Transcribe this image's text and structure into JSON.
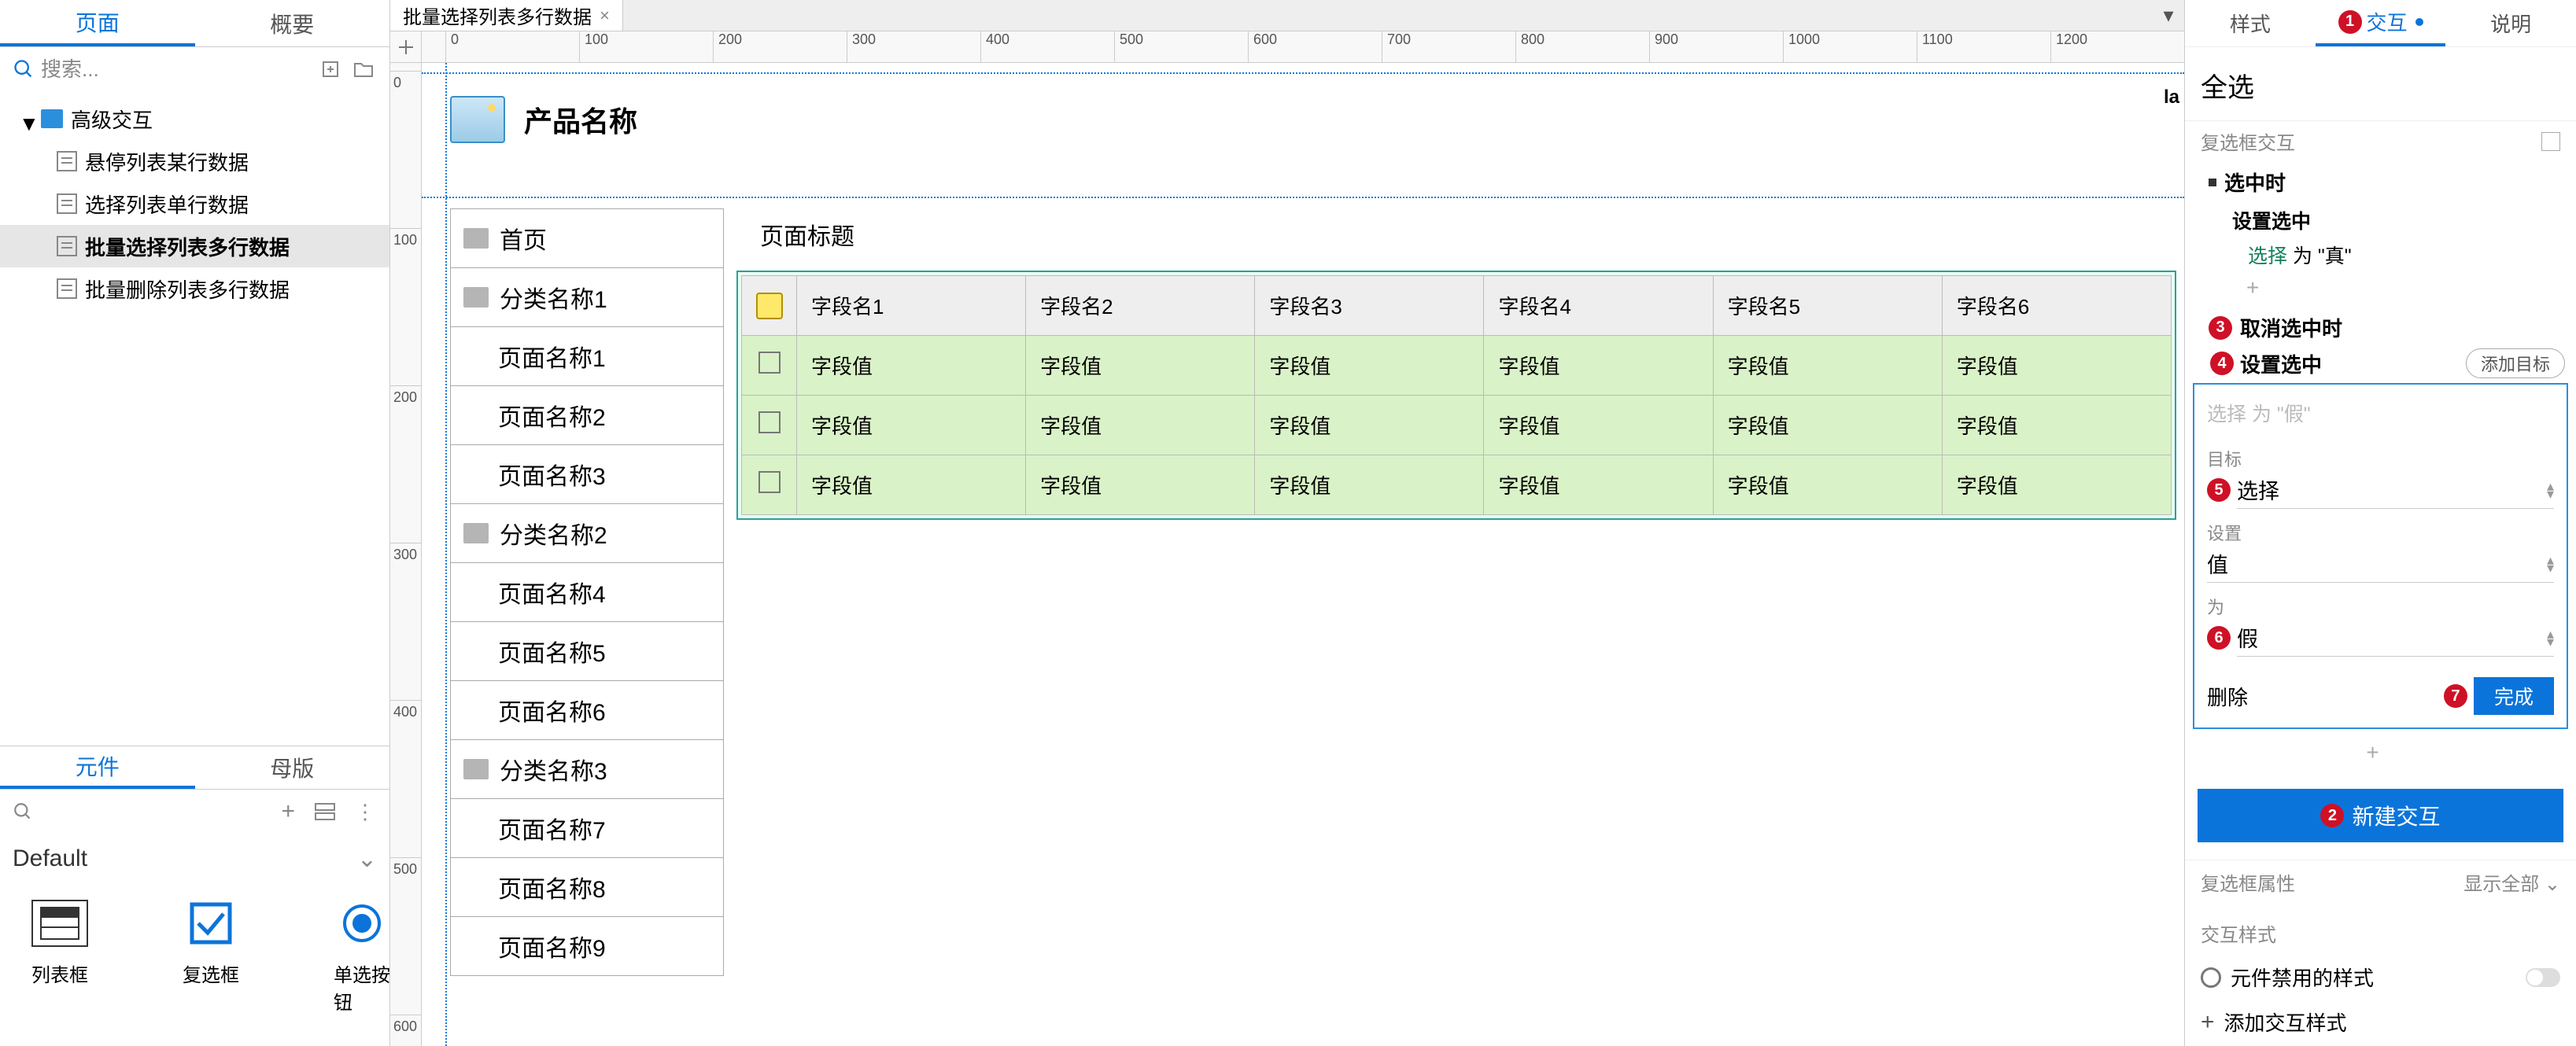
{
  "left_panel": {
    "tabs": {
      "page": "页面",
      "summary": "概要"
    },
    "search_placeholder": "搜索...",
    "tree": {
      "root": "高级交互",
      "items": [
        "悬停列表某行数据",
        "选择列表单行数据",
        "批量选择列表多行数据",
        "批量删除列表多行数据"
      ],
      "selected_index": 2
    },
    "widget_tabs": {
      "widget": "元件",
      "master": "母版"
    },
    "library": "Default",
    "widgets": [
      {
        "key": "listbox",
        "label": "列表框"
      },
      {
        "key": "checkbox",
        "label": "复选框"
      },
      {
        "key": "radio",
        "label": "单选按钮"
      }
    ]
  },
  "doc_tabs": {
    "active": "批量选择列表多行数据"
  },
  "ruler_h": [
    "0",
    "100",
    "200",
    "300",
    "400",
    "500",
    "600",
    "700",
    "800",
    "900",
    "1000",
    "1100",
    "1200"
  ],
  "ruler_v": [
    "0",
    "100",
    "200",
    "300",
    "400",
    "500",
    "600"
  ],
  "canvas": {
    "la": "la",
    "product_title": "产品名称",
    "nav": {
      "home": "首页",
      "cats": [
        {
          "label": "分类名称1",
          "pages": [
            "页面名称1",
            "页面名称2",
            "页面名称3"
          ]
        },
        {
          "label": "分类名称2",
          "pages": [
            "页面名称4",
            "页面名称5",
            "页面名称6"
          ]
        },
        {
          "label": "分类名称3",
          "pages": [
            "页面名称7",
            "页面名称8",
            "页面名称9"
          ]
        }
      ]
    },
    "content_title": "页面标题",
    "table": {
      "headers": [
        "字段名1",
        "字段名2",
        "字段名3",
        "字段名4",
        "字段名5",
        "字段名6"
      ],
      "cell": "字段值",
      "row_count": 3
    }
  },
  "right_panel": {
    "tabs": {
      "style": "样式",
      "interact": "交互",
      "notes": "说明"
    },
    "element_name": "全选",
    "section_checkbox": "复选框交互",
    "triggers": {
      "on_select": "选中时",
      "on_unselect": "取消选中时"
    },
    "action_set_selected": "设置选中",
    "desc_select": "选择",
    "desc_to_true": " 为 \"真\"",
    "plus": "+",
    "editor": {
      "add_target": "添加目标",
      "placeholder": "选择 为 \"假\"",
      "label_target": "目标",
      "value_target": "选择",
      "label_set": "设置",
      "value_set": "值",
      "label_to": "为",
      "value_to": "假",
      "delete": "删除",
      "done": "完成"
    },
    "new_interaction": "新建交互",
    "section_props": "复选框属性",
    "show_all": "显示全部",
    "section_styles": "交互样式",
    "disabled_style": "元件禁用的样式",
    "add_style": "添加交互样式"
  },
  "badges": {
    "b1": "1",
    "b2": "2",
    "b3": "3",
    "b4": "4",
    "b5": "5",
    "b6": "6",
    "b7": "7"
  }
}
